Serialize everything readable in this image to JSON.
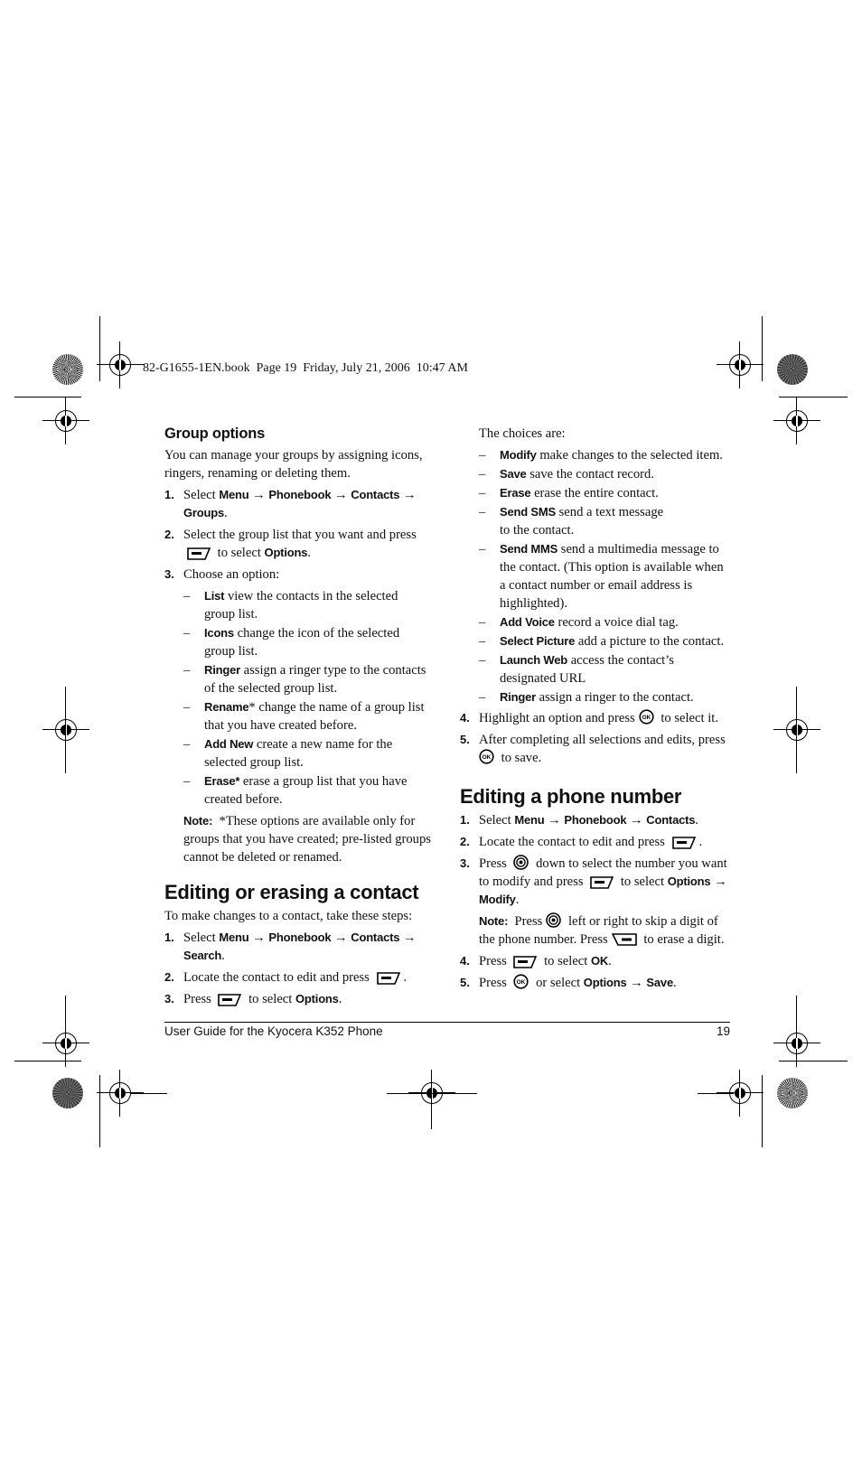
{
  "print_header": "82-G1655-1EN.book  Page 19  Friday, July 21, 2006  10:47 AM",
  "left_column": {
    "group_options": {
      "heading": "Group options",
      "intro": "You can manage your groups by assigning icons, ringers, renaming or deleting them.",
      "step1": {
        "num": "1.",
        "pre": "Select ",
        "path": [
          "Menu",
          "Phonebook",
          "Contacts",
          "Groups"
        ],
        "arrow": "→",
        "post": "."
      },
      "step2": {
        "num": "2.",
        "text": "Select the group list that you want and press",
        "post_icon": " to select ",
        "kw": "Options",
        "end": "."
      },
      "step3": {
        "num": "3.",
        "text": "Choose an option:"
      },
      "dash": "–",
      "options": [
        {
          "kw": "List",
          "text": " view the contacts in the selected group list."
        },
        {
          "kw": "Icons",
          "text": " change the icon of the selected group list."
        },
        {
          "kw": "Ringer",
          "text": " assign a ringer type to the contacts of the selected group list."
        },
        {
          "kw": "Rename",
          "text": "* change the name of a group list that you have created before."
        },
        {
          "kw": "Add New",
          "text": " create a new name for the selected group list."
        },
        {
          "kw": "Erase*",
          "text": " erase a group list that you have created before."
        }
      ],
      "note_label": "Note:",
      "note_text": "  *These options are available only for groups that you have created; pre-listed groups cannot be deleted or renamed."
    },
    "editing_contact": {
      "heading": "Editing or erasing a contact",
      "intro": "To make changes to a contact, take these steps:",
      "step1": {
        "num": "1.",
        "pre": "Select ",
        "path": [
          "Menu",
          "Phonebook",
          "Contacts",
          "Search"
        ],
        "post": "."
      },
      "step2": {
        "num": "2.",
        "text": "Locate the contact to edit and press",
        "end": "."
      },
      "step3": {
        "num": "3.",
        "text": "Press",
        "post_icon": " to select ",
        "kw": "Options",
        "end": "."
      }
    }
  },
  "right_column": {
    "choices_intro": "The choices are:",
    "choices": [
      {
        "kw": "Modify",
        "text": " make changes to the selected item."
      },
      {
        "kw": "Save",
        "text": " save the contact record."
      },
      {
        "kw": "Erase",
        "text": " erase the entire contact."
      },
      {
        "kw": "Send SMS",
        "text": " send a text message to the contact."
      },
      {
        "kw": "Send MMS",
        "text": " send a multimedia message to the contact. (This option is available when a contact number or email address is highlighted)."
      },
      {
        "kw": "Add Voice",
        "text": " record a voice dial tag."
      },
      {
        "kw": "Select Picture",
        "text": " add a picture to the contact."
      },
      {
        "kw": "Launch Web",
        "text": " access the contact’s designated URL"
      },
      {
        "kw": "Ringer",
        "text": " assign a ringer to the contact."
      }
    ],
    "step4": {
      "num": "4.",
      "text": "Highlight an option and press",
      "post": " to select it."
    },
    "step5": {
      "num": "5.",
      "text": "After completing all selections and edits, press",
      "post": " to save."
    },
    "editing_number": {
      "heading": "Editing a phone number",
      "step1": {
        "num": "1.",
        "pre": "Select ",
        "path": [
          "Menu",
          "Phonebook",
          "Contacts"
        ],
        "post": "."
      },
      "step2": {
        "num": "2.",
        "text": "Locate the contact to edit and press",
        "end": "."
      },
      "step3": {
        "num": "3.",
        "pre": "Press",
        "mid": " down to select the number you want to modify and press",
        "post": " to select ",
        "path": [
          "Options",
          "Modify"
        ],
        "end": "."
      },
      "note_label": "Note:",
      "note_pre": "  Press",
      "note_mid": " left or right to skip a digit of the phone number. Press",
      "note_end": " to erase a digit.",
      "step4": {
        "num": "4.",
        "pre": "Press",
        "post": " to select ",
        "kw": "OK",
        "end": "."
      },
      "step5": {
        "num": "5.",
        "pre": "Press",
        "post": " or select ",
        "path": [
          "Options",
          "Save"
        ],
        "end": "."
      }
    }
  },
  "footer": {
    "title": "User Guide for the Kyocera K352 Phone",
    "page_number": "19"
  },
  "icons": {
    "softkey": "left-softkey-icon",
    "ok": "ok-key-icon",
    "nav": "navigation-key-icon",
    "clear": "clear-key-icon"
  }
}
